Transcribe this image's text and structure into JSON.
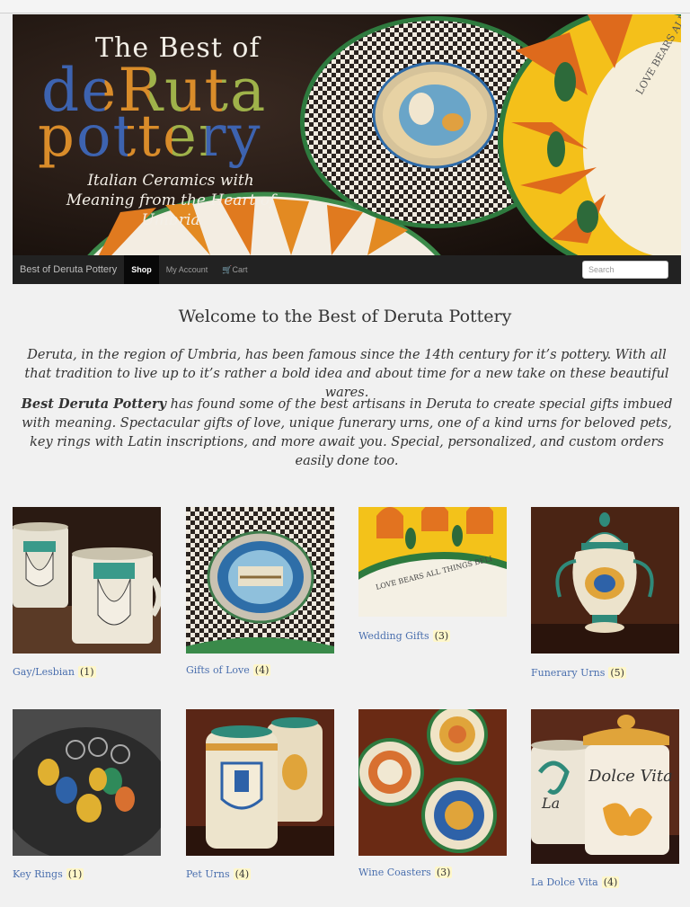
{
  "banner": {
    "best_of": "The Best of",
    "deruta": "deRuta",
    "pottery": "pottery",
    "tagline_line1": "Italian Ceramics with",
    "tagline_line2": "Meaning from the Heart of Umbria",
    "plate_text": "LOVE BEARS ALL THINGS"
  },
  "nav": {
    "brand": "Best of Deruta Pottery",
    "items": [
      "Shop",
      "My Account",
      "Cart"
    ],
    "cart_icon": "cart-icon",
    "search_placeholder": "Search"
  },
  "intro": {
    "heading": "Welcome to the Best of Deruta Pottery",
    "para1": "Deruta, in the region of Umbria, has been famous since the 14th century for it’s pottery. With all that tradition to live up to it’s rather a bold idea and about time for a new take on these beautiful wares.",
    "para2_bold": "Best Deruta Pottery",
    "para2_rest": " has found some of the best artisans in Deruta to create special gifts imbued with meaning. Spectacular gifts of love, unique  funerary urns, one of a kind urns for beloved pets, key rings with Latin inscriptions, and more await you. Special, personalized, and custom orders easily done too."
  },
  "categories": [
    {
      "name": "Gay/Lesbian",
      "count": "(1)"
    },
    {
      "name": "Gifts of Love",
      "count": "(4)"
    },
    {
      "name": "Wedding Gifts",
      "count": "(3)"
    },
    {
      "name": "Funerary Urns",
      "count": "(5)"
    },
    {
      "name": "Key Rings",
      "count": "(1)"
    },
    {
      "name": "Pet Urns",
      "count": "(4)"
    },
    {
      "name": "Wine Coasters",
      "count": "(3)"
    },
    {
      "name": "La Dolce Vita",
      "count": "(4)"
    }
  ],
  "image_labels": {
    "wedding_plate": "LOVE BEARS ALL THINGS BELI",
    "dolce_vita": "Dolce Vita",
    "la": "La"
  },
  "colors": {
    "nav_bg": "#222222",
    "link": "#4a6fae",
    "logo_blue": "#3d63b0",
    "logo_orange": "#d98c2a",
    "logo_green": "#9fb24a"
  }
}
